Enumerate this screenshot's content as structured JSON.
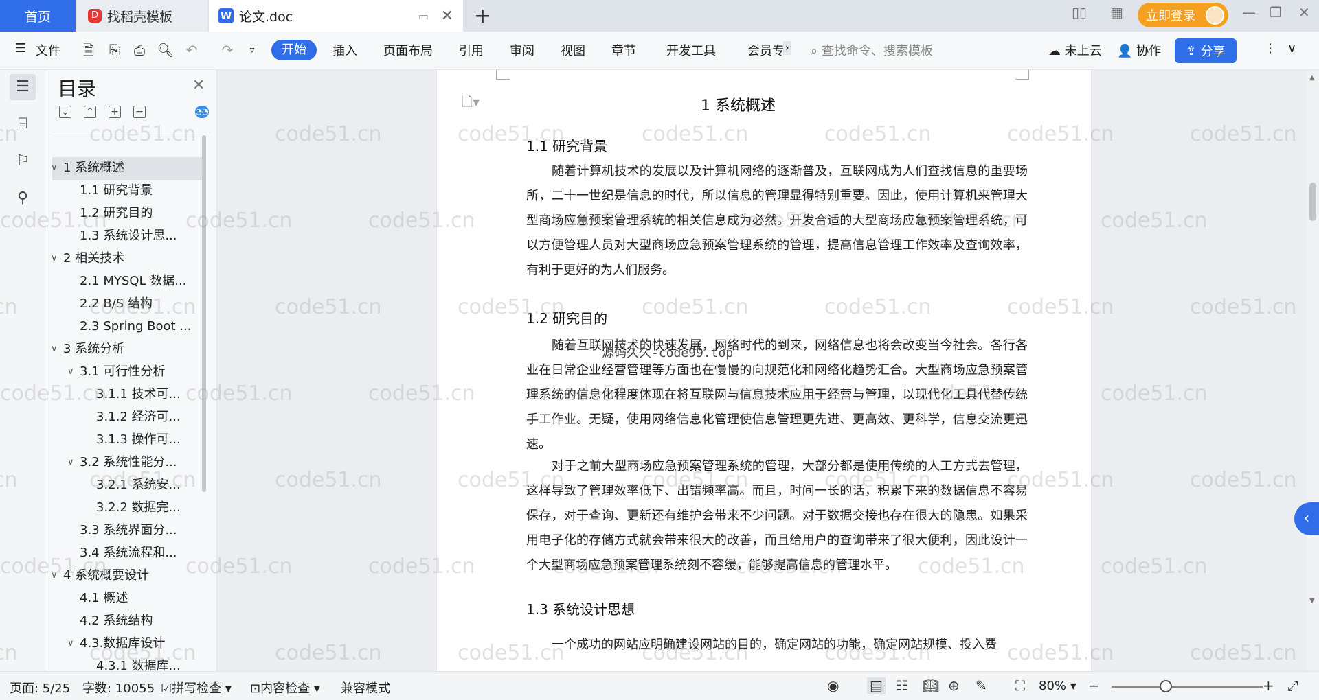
{
  "tabs": {
    "home": "首页",
    "template": "找稻壳模板",
    "doc": "论文.doc"
  },
  "login": "立即登录",
  "menu": {
    "file": "文件",
    "start": "开始",
    "insert": "插入",
    "layout": "页面布局",
    "reference": "引用",
    "review": "审阅",
    "view": "视图",
    "chapter": "章节",
    "dev": "开发工具",
    "member": "会员专"
  },
  "search_placeholder": "查找命令、搜索模板",
  "cloud": "未上云",
  "collab": "协作",
  "share": "分享",
  "toc": {
    "title": "目录",
    "items": [
      {
        "label": "1 系统概述",
        "level": 1,
        "caret": "open"
      },
      {
        "label": "1.1 研究背景",
        "level": 2
      },
      {
        "label": "1.2 研究目的",
        "level": 2
      },
      {
        "label": "1.3 系统设计思...",
        "level": 2
      },
      {
        "label": "2 相关技术",
        "level": 1,
        "caret": "open"
      },
      {
        "label": "2.1 MYSQL 数据...",
        "level": 2
      },
      {
        "label": "2.2 B/S 结构",
        "level": 2
      },
      {
        "label": "2.3 Spring Boot ...",
        "level": 2
      },
      {
        "label": "3 系统分析",
        "level": 1,
        "caret": "open"
      },
      {
        "label": "3.1 可行性分析",
        "level": 2,
        "caret": "open"
      },
      {
        "label": "3.1.1 技术可...",
        "level": 3
      },
      {
        "label": "3.1.2 经济可...",
        "level": 3
      },
      {
        "label": "3.1.3 操作可...",
        "level": 3
      },
      {
        "label": "3.2 系统性能分...",
        "level": 2,
        "caret": "open"
      },
      {
        "label": "3.2.1 系统安...",
        "level": 3
      },
      {
        "label": "3.2.2 数据完...",
        "level": 3
      },
      {
        "label": "3.3 系统界面分...",
        "level": 2
      },
      {
        "label": "3.4 系统流程和...",
        "level": 2
      },
      {
        "label": "4 系统概要设计",
        "level": 1,
        "caret": "open"
      },
      {
        "label": "4.1 概述",
        "level": 2
      },
      {
        "label": "4.2 系统结构",
        "level": 2
      },
      {
        "label": "4.3.数据库设计",
        "level": 2,
        "caret": "open"
      },
      {
        "label": "4.3.1 数据库...",
        "level": 3
      }
    ]
  },
  "doc": {
    "h1": "1 系统概述",
    "s11": "1.1  研究背景",
    "p1": "随着计算机技术的发展以及计算机网络的逐渐普及，互联网成为人们查找信息的重要场所，二十一世纪是信息的时代，所以信息的管理显得特别重要。因此，使用计算机来管理大型商场应急预案管理系统的相关信息成为必然。开发合适的大型商场应急预案管理系统，可以方便管理人员对大型商场应急预案管理系统的管理，提高信息管理工作效率及查询效率，有利于更好的为人们服务。",
    "s12": "1.2 研究目的",
    "p2": "随着互联网技术的快速发展，网络时代的到来，网络信息也将会改变当今社会。各行各业在日常企业经营管理等方面也在慢慢的向规范化和网络化趋势汇合。大型商场应急预案管理系统的信息化程度体现在将互联网与信息技术应用于经营与管理，以现代化工具代替传统手工作业。无疑，使用网络信息化管理使信息管理更先进、更高效、更科学，信息交流更迅速。",
    "p3": "对于之前大型商场应急预案管理系统的管理，大部分都是使用传统的人工方式去管理，这样导致了管理效率低下、出错频率高。而且，时间一长的话，积累下来的数据信息不容易保存，对于查询、更新还有维护会带来不少问题。对于数据交接也存在很大的隐患。如果采用电子化的存储方式就会带来很大的改善，而且给用户的查询带来了很大便利，因此设计一个大型商场应急预案管理系统刻不容缓，能够提高信息的管理水平。",
    "s13": "1.3 系统设计思想",
    "p4": "一个成功的网站应明确建设网站的目的，确定网站的功能，确定网站规模、投入费"
  },
  "watermark": "code51.cn",
  "center_watermark": "源码久久-code99.top",
  "status": {
    "page": "页面: 5/25",
    "words": "字数: 10055",
    "spell": "拼写检查",
    "content_check": "内容检查",
    "compat": "兼容模式",
    "zoom": "80%"
  }
}
